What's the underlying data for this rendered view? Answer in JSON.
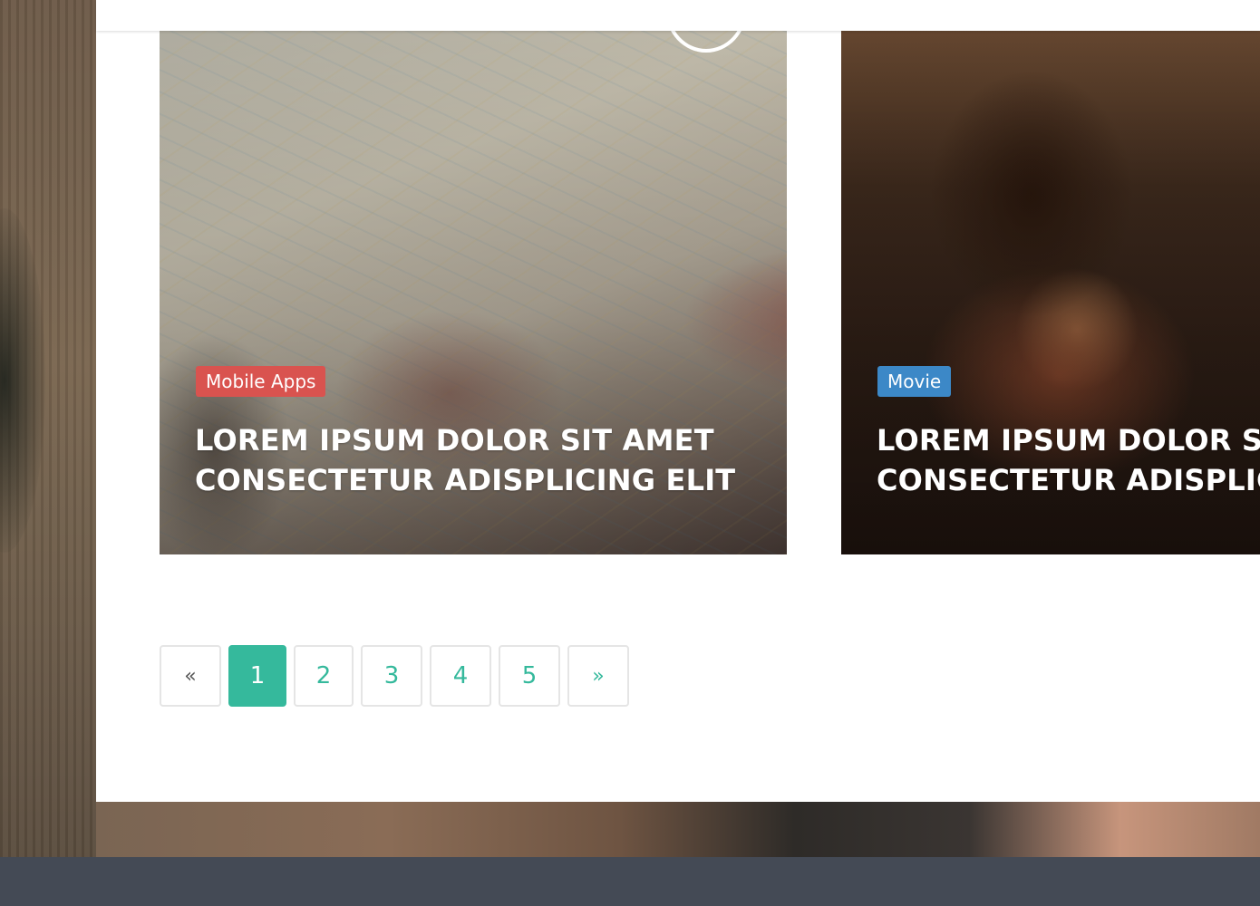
{
  "cards": [
    {
      "category": "Mobile Apps",
      "category_color": "#d9534f",
      "title_line1": "LOREM IPSUM DOLOR SIT AMET",
      "title_line2": "CONSECTETUR ADISPLICING ELIT"
    },
    {
      "category": "Movie",
      "category_color": "#3c88c7",
      "title_line1": "LOREM IPSUM DOLOR SIT AMET",
      "title_line2": "CONSECTETUR ADISPLICING ELIT"
    }
  ],
  "pagination": {
    "prev": "«",
    "pages": [
      "1",
      "2",
      "3",
      "4",
      "5"
    ],
    "current": "1",
    "next": "»",
    "accent_color": "#35b99c"
  },
  "footer": {
    "background": "#444a55"
  }
}
